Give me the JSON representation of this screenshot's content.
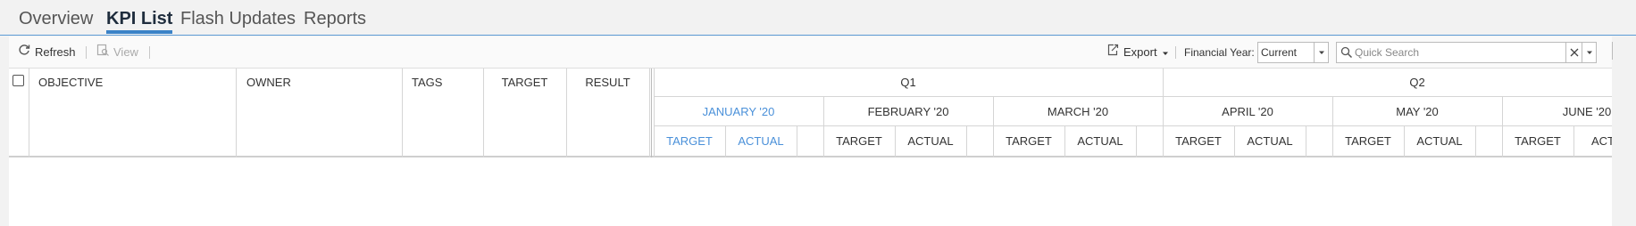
{
  "tabs": [
    {
      "label": "Overview"
    },
    {
      "label": "KPI List"
    },
    {
      "label": "Flash Updates"
    },
    {
      "label": "Reports"
    }
  ],
  "toolbar": {
    "refresh_label": "Refresh",
    "view_label": "View",
    "export_label": "Export",
    "financial_year_label": "Financial Year:",
    "financial_year_value": "Current",
    "search_placeholder": "Quick Search"
  },
  "grid": {
    "columns": {
      "objective": "OBJECTIVE",
      "owner": "OWNER",
      "tags": "TAGS",
      "target": "TARGET",
      "result": "RESULT"
    },
    "quarters": [
      "Q1",
      "Q2"
    ],
    "months": [
      "JANUARY '20",
      "FEBRUARY '20",
      "MARCH '20",
      "APRIL '20",
      "MAY '20",
      "JUNE '20"
    ],
    "sub_target": "TARGET",
    "sub_actual": "ACTUAL"
  },
  "colors": {
    "accent": "#3a82c7",
    "highlight": "#4a90d9"
  }
}
